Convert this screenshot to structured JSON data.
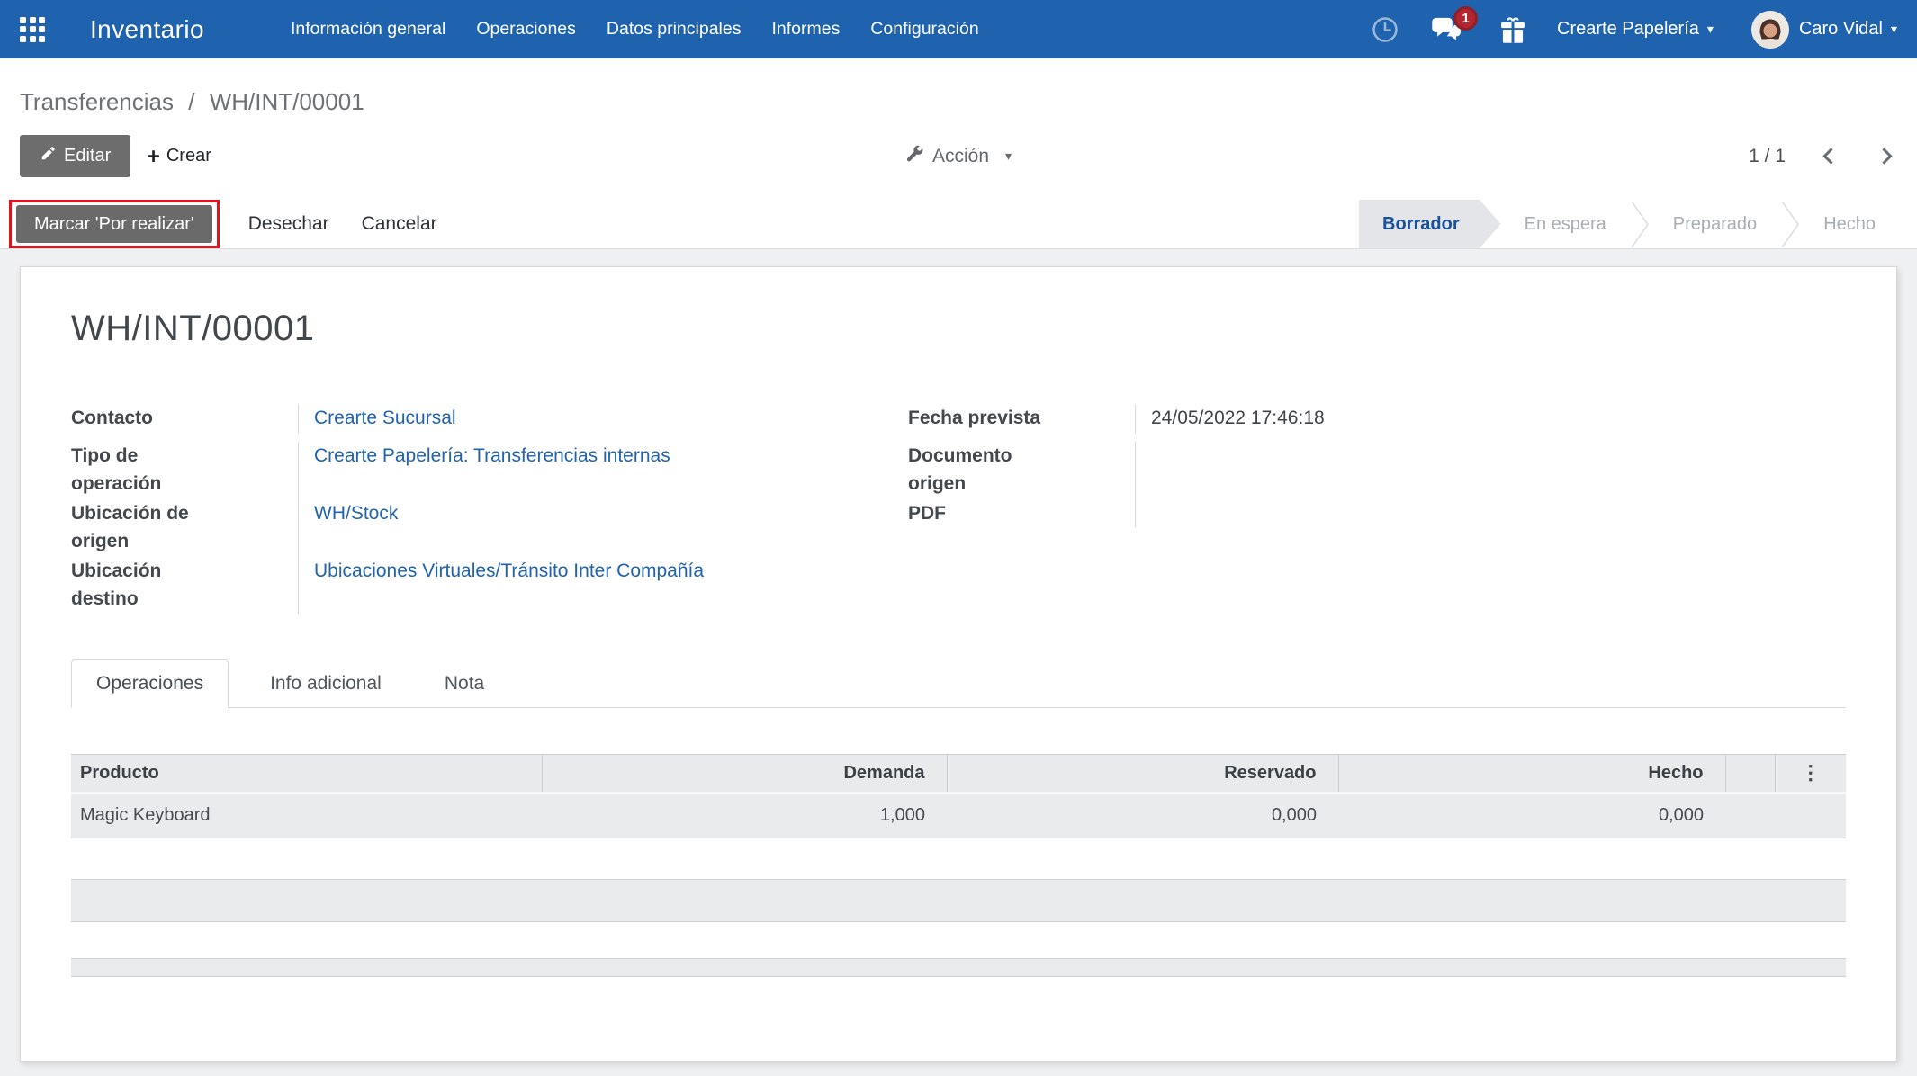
{
  "navbar": {
    "app_name": "Inventario",
    "menus": [
      {
        "label": "Información general"
      },
      {
        "label": "Operaciones"
      },
      {
        "label": "Datos principales"
      },
      {
        "label": "Informes"
      },
      {
        "label": "Configuración"
      }
    ],
    "message_badge": "1",
    "company": "Crearte Papelería",
    "user": "Caro Vidal"
  },
  "control_panel": {
    "breadcrumb_root": "Transferencias",
    "breadcrumb_separator": "/",
    "breadcrumb_current": "WH/INT/00001",
    "edit_button": "Editar",
    "create_button": "Crear",
    "action_button": "Acción",
    "pager": "1 / 1"
  },
  "statusbar": {
    "mark_todo_button": "Marcar 'Por realizar'",
    "scrap_button": "Desechar",
    "cancel_button": "Cancelar",
    "steps": [
      {
        "label": "Borrador"
      },
      {
        "label": "En espera"
      },
      {
        "label": "Preparado"
      },
      {
        "label": "Hecho"
      }
    ]
  },
  "form": {
    "title": "WH/INT/00001",
    "left_fields": [
      {
        "label": "Contacto",
        "value": "Crearte Sucursal"
      },
      {
        "label": "Tipo de operación",
        "value": "Crearte Papelería: Transferencias internas"
      },
      {
        "label": "Ubicación de origen",
        "value": "WH/Stock"
      },
      {
        "label": "Ubicación destino",
        "value": "Ubicaciones Virtuales/Tránsito Inter Compañía"
      }
    ],
    "right_fields": [
      {
        "label": "Fecha prevista",
        "value": "24/05/2022 17:46:18"
      },
      {
        "label": "Documento origen",
        "value": ""
      },
      {
        "label": "PDF",
        "value": ""
      }
    ],
    "tabs": [
      {
        "label": "Operaciones"
      },
      {
        "label": "Info adicional"
      },
      {
        "label": "Nota"
      }
    ],
    "table": {
      "headers": {
        "product": "Producto",
        "demand": "Demanda",
        "reserved": "Reservado",
        "done": "Hecho"
      },
      "rows": [
        {
          "product": "Magic Keyboard",
          "demand": "1,000",
          "reserved": "0,000",
          "done": "0,000"
        }
      ]
    }
  },
  "icons": {
    "kebab": "⋮",
    "caret_down": "▾"
  },
  "colors": {
    "navbar_blue": "#1f63ae",
    "link_blue": "#2263ae",
    "active_step_blue": "#19519f",
    "annotation_red": "#e2121e",
    "button_gray": "#6d6d6d",
    "badge_red": "#b5252f"
  }
}
